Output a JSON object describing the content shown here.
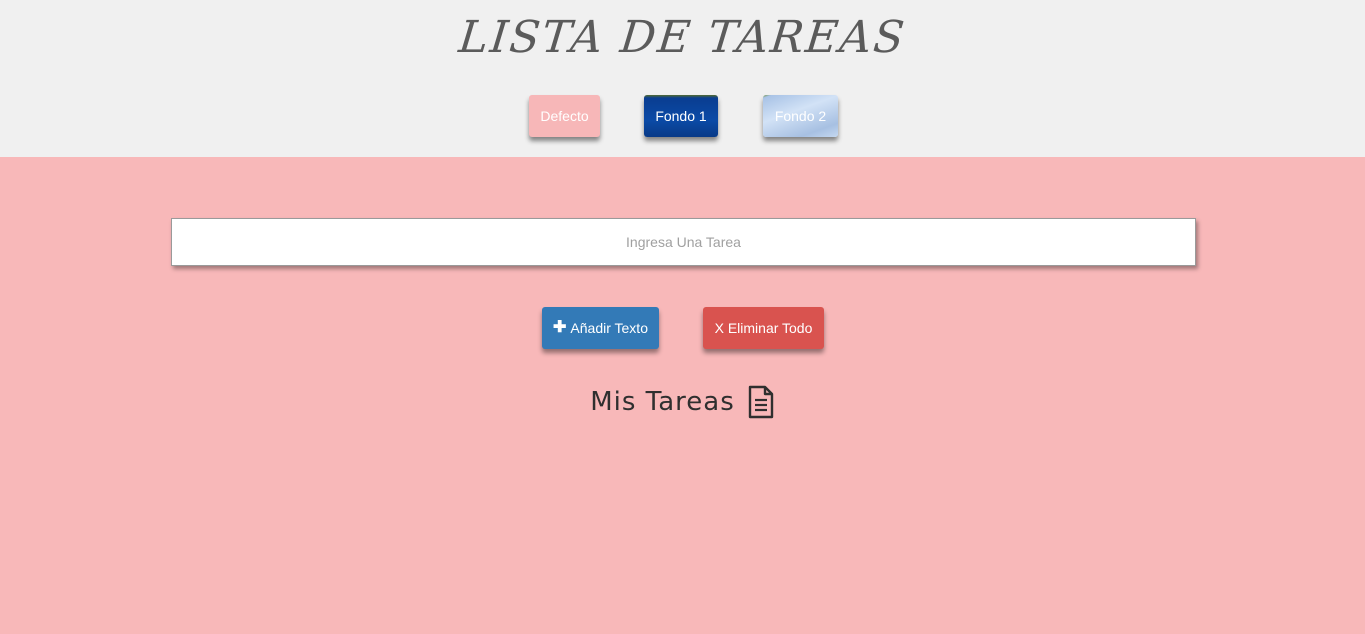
{
  "header": {
    "title": "LISTA DE TAREAS",
    "background_buttons": [
      {
        "label": "Defecto"
      },
      {
        "label": "Fondo 1"
      },
      {
        "label": "Fondo 2"
      }
    ]
  },
  "form": {
    "task_placeholder": "Ingresa Una Tarea",
    "task_value": "",
    "add_label": "Añadir Texto",
    "add_icon": "plus-icon",
    "clear_label": "X Eliminar Todo"
  },
  "tasks": {
    "title": "Mis Tareas",
    "title_icon": "document-icon",
    "items": []
  },
  "colors": {
    "header_bg": "#f0f0f0",
    "page_bg": "#f8b8b9",
    "add_button": "#337ab7",
    "clear_button": "#d9534f",
    "defecto_button": "#f7b7b8",
    "fondo1_button": "#0b4aa6",
    "fondo2_button": "#c5d8f0"
  }
}
